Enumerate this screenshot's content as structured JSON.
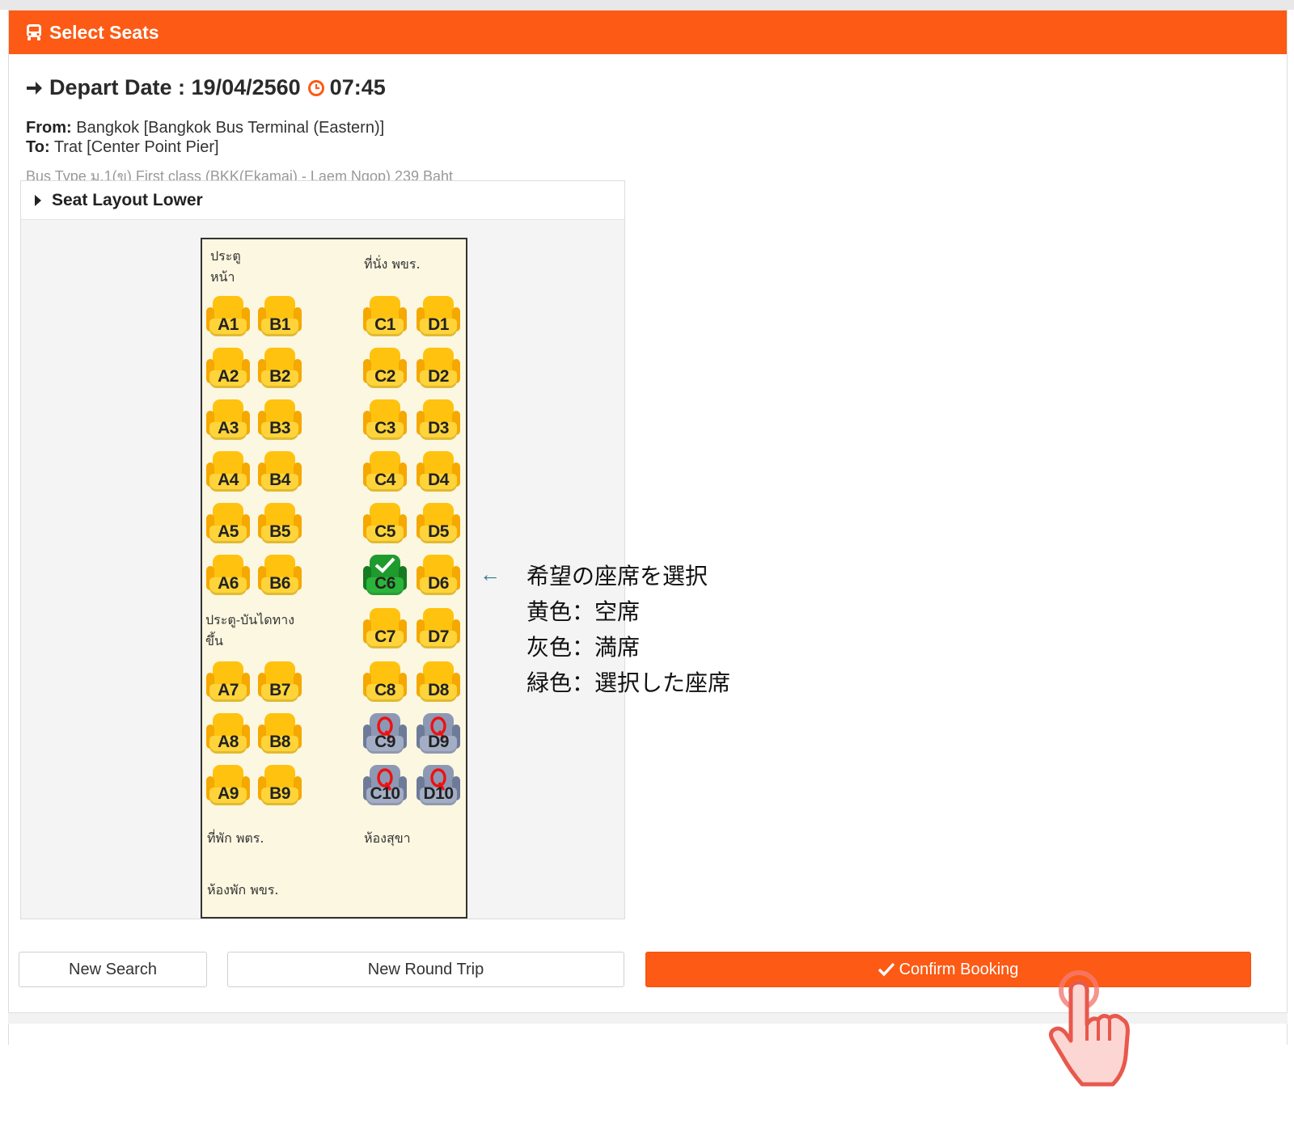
{
  "header": {
    "title": "Select Seats"
  },
  "trip": {
    "depart_label": "Depart Date : 19/04/2560",
    "depart_time": "07:45",
    "from_label": "From:",
    "from_value": "Bangkok [Bangkok Bus Terminal (Eastern)]",
    "to_label": "To:",
    "to_value": "Trat [Center Point Pier]",
    "bus_type": "Bus Type ม.1(ข) First class (BKK(Ekamai) - Laem Ngop) 239 Baht"
  },
  "layout": {
    "title": "Seat Layout Lower",
    "notes": {
      "front_door": "ประตู\nหน้า",
      "staff_seat": "ที่นั่ง พขร.",
      "stair_door": "ประตู-บันไดทาง\nขึ้น",
      "staff_rest": "ที่พัก พตร.",
      "toilet": "ห้องสุขา",
      "driver_room": "ห้องพัก พขร."
    },
    "seats": [
      {
        "id": "A1",
        "status": "available"
      },
      {
        "id": "B1",
        "status": "available"
      },
      {
        "id": "C1",
        "status": "available"
      },
      {
        "id": "D1",
        "status": "available"
      },
      {
        "id": "A2",
        "status": "available"
      },
      {
        "id": "B2",
        "status": "available"
      },
      {
        "id": "C2",
        "status": "available"
      },
      {
        "id": "D2",
        "status": "available"
      },
      {
        "id": "A3",
        "status": "available"
      },
      {
        "id": "B3",
        "status": "available"
      },
      {
        "id": "C3",
        "status": "available"
      },
      {
        "id": "D3",
        "status": "available"
      },
      {
        "id": "A4",
        "status": "available"
      },
      {
        "id": "B4",
        "status": "available"
      },
      {
        "id": "C4",
        "status": "available"
      },
      {
        "id": "D4",
        "status": "available"
      },
      {
        "id": "A5",
        "status": "available"
      },
      {
        "id": "B5",
        "status": "available"
      },
      {
        "id": "C5",
        "status": "available"
      },
      {
        "id": "D5",
        "status": "available"
      },
      {
        "id": "A6",
        "status": "available"
      },
      {
        "id": "B6",
        "status": "available"
      },
      {
        "id": "C6",
        "status": "selected"
      },
      {
        "id": "D6",
        "status": "available"
      },
      {
        "id": "C7",
        "status": "available"
      },
      {
        "id": "D7",
        "status": "available"
      },
      {
        "id": "A7",
        "status": "available"
      },
      {
        "id": "B7",
        "status": "available"
      },
      {
        "id": "C8",
        "status": "available"
      },
      {
        "id": "D8",
        "status": "available"
      },
      {
        "id": "A8",
        "status": "available"
      },
      {
        "id": "B8",
        "status": "available"
      },
      {
        "id": "C9",
        "status": "sold"
      },
      {
        "id": "D9",
        "status": "sold"
      },
      {
        "id": "A9",
        "status": "available"
      },
      {
        "id": "B9",
        "status": "available"
      },
      {
        "id": "C10",
        "status": "sold"
      },
      {
        "id": "D10",
        "status": "sold"
      }
    ]
  },
  "legend": {
    "arrow": "←",
    "lines": [
      "希望の座席を選択",
      "黄色：空席",
      "灰色：満席",
      "緑色：選択した座席"
    ]
  },
  "buttons": {
    "new_search": "New Search",
    "new_round_trip": "New Round Trip",
    "confirm": "Confirm Booking"
  },
  "colors": {
    "accent": "#fc5a15",
    "seat_available": "#ffc20f",
    "seat_sold": "#8d99b4",
    "seat_selected": "#1f9a2c"
  },
  "icons": {
    "header": "bus-icon",
    "depart": "arrow-right-icon",
    "time": "clock-icon",
    "layout_toggle": "caret-right-icon",
    "confirm": "check-icon",
    "pointer": "hand-pointer-icon"
  }
}
